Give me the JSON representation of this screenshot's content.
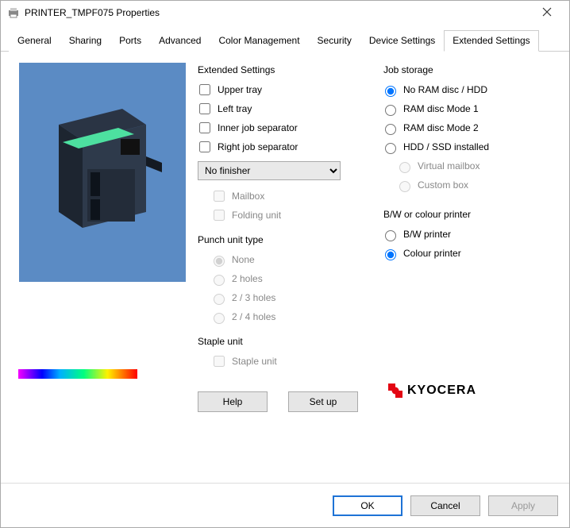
{
  "window": {
    "title": "PRINTER_TMPF075 Properties"
  },
  "tabs": {
    "items": [
      {
        "label": "General"
      },
      {
        "label": "Sharing"
      },
      {
        "label": "Ports"
      },
      {
        "label": "Advanced"
      },
      {
        "label": "Color Management"
      },
      {
        "label": "Security"
      },
      {
        "label": "Device Settings"
      },
      {
        "label": "Extended Settings"
      }
    ],
    "active_index": 7
  },
  "extended": {
    "group_label": "Extended Settings",
    "upper_tray": "Upper tray",
    "left_tray": "Left tray",
    "inner_job_sep": "Inner job separator",
    "right_job_sep": "Right job separator",
    "finisher_selected": "No finisher",
    "mailbox": "Mailbox",
    "folding_unit": "Folding unit"
  },
  "punch": {
    "group_label": "Punch unit type",
    "none": "None",
    "two": "2 holes",
    "two_three": "2 / 3 holes",
    "two_four": "2 / 4 holes"
  },
  "staple": {
    "group_label": "Staple unit",
    "staple_unit": "Staple unit"
  },
  "storage": {
    "group_label": "Job storage",
    "no_ram": "No RAM disc / HDD",
    "ram1": "RAM disc Mode 1",
    "ram2": "RAM disc Mode 2",
    "hdd": "HDD / SSD installed",
    "vmail": "Virtual mailbox",
    "cbox": "Custom box"
  },
  "bw": {
    "group_label": "B/W or colour printer",
    "bw": "B/W printer",
    "colour": "Colour printer"
  },
  "buttons": {
    "help": "Help",
    "setup": "Set up",
    "ok": "OK",
    "cancel": "Cancel",
    "apply": "Apply"
  },
  "brand": {
    "name": "KYOCERA"
  }
}
